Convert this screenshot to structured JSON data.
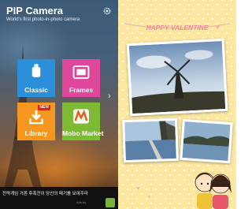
{
  "app": {
    "title": "PIP Camera",
    "subtitle": "World's first photo-in-photo camera"
  },
  "menu": {
    "classic": "Classic",
    "frames": "Frames",
    "library": "Library",
    "library_badge": "NEW",
    "mobo": "Mobo Market"
  },
  "ad": {
    "text": "전략게임 거론 후폭전이 당신의 패기를 보여주라",
    "by": "Ads by"
  },
  "frame": {
    "title": "HAPPY VALENTINE"
  },
  "icons": [
    "gear-icon",
    "camera-icon",
    "frame-icon",
    "download-icon",
    "mobo-icon",
    "arrow-right-icon",
    "android-icon"
  ],
  "colors": {
    "classic_tile": "#2c8fd9",
    "frames_tile": "#e0469c",
    "library_tile": "#f5961e",
    "mobo_tile": "#7dbb34",
    "frame_background": "#fbe7a0",
    "valentine_text": "#f08a9e"
  }
}
